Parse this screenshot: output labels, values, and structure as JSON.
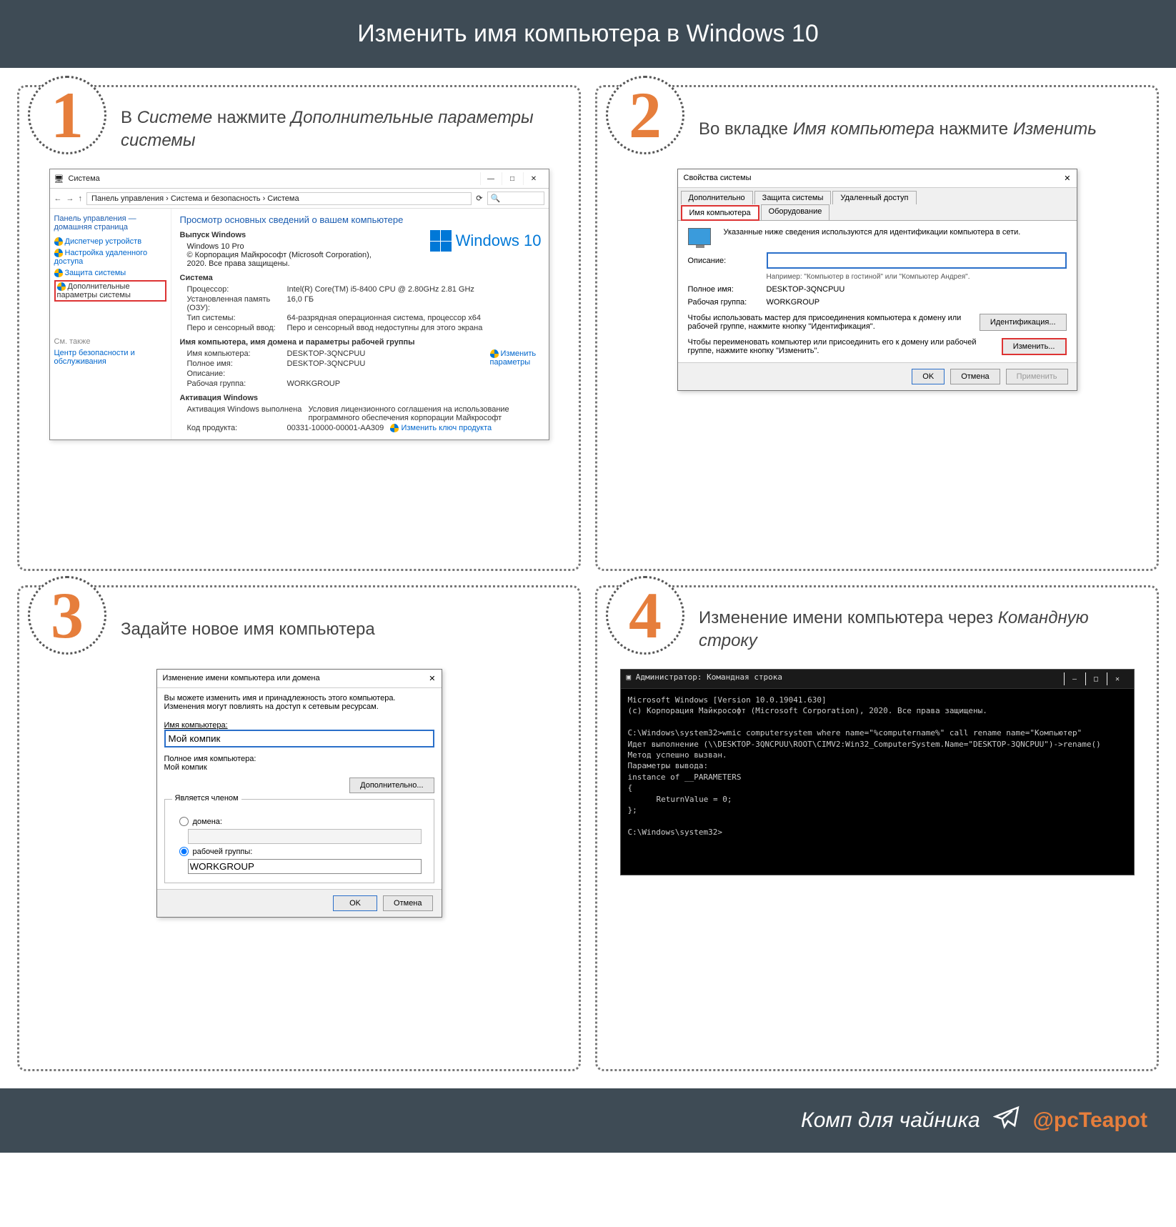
{
  "header": "Изменить имя компьютера в Windows 10",
  "footer": {
    "text": "Комп для чайника",
    "handle": "@pcTeapot"
  },
  "steps": {
    "s1": {
      "num": "1",
      "cap_a": "В ",
      "cap_b": "Системе",
      "cap_c": " нажмите ",
      "cap_d": "Дополни­тельные параметры системы"
    },
    "s2": {
      "num": "2",
      "cap_a": "Во вкладке ",
      "cap_b": "Имя компьютера",
      "cap_c": " нажмите ",
      "cap_d": "Изменить"
    },
    "s3": {
      "num": "3",
      "cap": "Задайте новое имя компьютера"
    },
    "s4": {
      "num": "4",
      "cap_a": "Изменение имени компьютера через ",
      "cap_b": "Командную строку"
    }
  },
  "system_window": {
    "title": "Система",
    "crumbs": "Панель управления › Система и безопасность › Система",
    "nav_back": "←",
    "nav_fwd": "→",
    "nav_up": "↑",
    "sidebar": {
      "home": "Панель управления — домашняя страница",
      "l1": "Диспетчер устройств",
      "l2": "Настройка удаленного доступа",
      "l3": "Защита системы",
      "l4": "Дополнительные параметры системы",
      "see_also": "См. также",
      "l5": "Центр безопасности и обслуживания"
    },
    "main": {
      "h": "Просмотр основных сведений о вашем компьютере",
      "logo": "Windows 10",
      "sec1": "Выпуск Windows",
      "edition": "Windows 10 Pro",
      "copyright": "© Корпорация Майкрософт (Microsoft Corporation), 2020. Все права защищены.",
      "sec2": "Система",
      "cpu_k": "Процессор:",
      "cpu_v": "Intel(R) Core(TM) i5-8400 CPU @ 2.80GHz  2.81 GHz",
      "ram_k": "Установленная память (ОЗУ):",
      "ram_v": "16,0 ГБ",
      "type_k": "Тип системы:",
      "type_v": "64-разрядная операционная система, процессор x64",
      "pen_k": "Перо и сенсорный ввод:",
      "pen_v": "Перо и сенсорный ввод недоступны для этого экрана",
      "sec3": "Имя компьютера, имя домена и параметры рабочей группы",
      "cname_k": "Имя компьютера:",
      "cname_v": "DESKTOP-3QNCPUU",
      "fname_k": "Полное имя:",
      "fname_v": "DESKTOP-3QNCPUU",
      "desc_k": "Описание:",
      "desc_v": "",
      "wg_k": "Рабочая группа:",
      "wg_v": "WORKGROUP",
      "change_params": "Изменить параметры",
      "sec4": "Активация Windows",
      "act_k": "Активация Windows выполнена",
      "act_v": "Условия лицензионного соглашения на использование программного обеспечения корпорации Майкрософт",
      "pid_k": "Код продукта:",
      "pid_v": "00331-10000-00001-AA309",
      "change_key": "Изменить ключ продукта"
    }
  },
  "props": {
    "title": "Свойства системы",
    "tabs": {
      "t1": "Дополнительно",
      "t2": "Защита системы",
      "t3": "Удаленный доступ",
      "t4": "Имя компьютера",
      "t5": "Оборудование"
    },
    "info": "Указанные ниже сведения используются для идентификации компьютера в сети.",
    "desc_lbl": "Описание:",
    "desc_hint": "Например: \"Компьютер в гостиной\" или \"Компьютер Андрея\".",
    "full_lbl": "Полное имя:",
    "full_val": "DESKTOP-3QNCPUU",
    "wg_lbl": "Рабочая группа:",
    "wg_val": "WORKGROUP",
    "wizard_txt": "Чтобы использовать мастер для присоединения компьютера к домену или рабочей группе, нажмите кнопку \"Идентификация\".",
    "id_btn": "Идентификация...",
    "change_txt": "Чтобы переименовать компьютер или присоединить его к домену или рабочей группе, нажмите кнопку \"Изменить\".",
    "change_btn": "Изменить...",
    "ok": "OK",
    "cancel": "Отмена",
    "apply": "Применить"
  },
  "rename": {
    "title": "Изменение имени компьютера или домена",
    "info": "Вы можете изменить имя и принадлежность этого компьютера. Изменения могут повлиять на доступ к сетевым ресурсам.",
    "name_lbl": "Имя компьютера:",
    "name_val": "Мой компик",
    "full_lbl": "Полное имя компьютера:",
    "full_val": "Мой компик",
    "more_btn": "Дополнительно...",
    "group_lbl": "Является членом",
    "r_domain": "домена:",
    "r_wg": "рабочей группы:",
    "wg_val": "WORKGROUP",
    "ok": "OK",
    "cancel": "Отмена"
  },
  "cmd": {
    "title": "Администратор: Командная строка",
    "l1": "Microsoft Windows [Version 10.0.19041.630]",
    "l2": "(c) Корпорация Майкрософт (Microsoft Corporation), 2020. Все права защищены.",
    "l3": "C:\\Windows\\system32>wmic computersystem where name=\"%computername%\" call rename name=\"Компьютер\"",
    "l4": "Идет выполнение (\\\\DESKTOP-3QNCPUU\\ROOT\\CIMV2:Win32_ComputerSystem.Name=\"DESKTOP-3QNCPUU\")->rename()",
    "l5": "Метод успешно вызван.",
    "l6": "Параметры вывода:",
    "l7": "instance of __PARAMETERS",
    "l8": "{",
    "l9": "ReturnValue = 0;",
    "l10": "};",
    "l11": "C:\\Windows\\system32>"
  }
}
